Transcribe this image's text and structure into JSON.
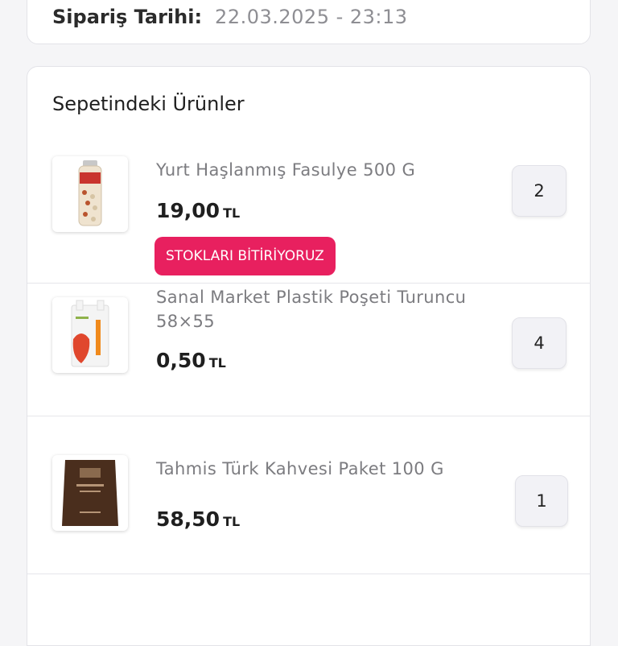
{
  "order": {
    "date_label": "Sipariş Tarihi:",
    "date_value": "22.03.2025 - 23:13"
  },
  "basket": {
    "title": "Sepetindeki Ürünler",
    "items": [
      {
        "name": "Yurt Haşlanmış Fasulye 500 G",
        "price": "19,00",
        "currency": "TL",
        "quantity": "2",
        "badge": "STOKLARI BİTİRİYORUZ"
      },
      {
        "name": "Sanal Market Plastik Poşeti Turuncu 58×55",
        "price": "0,50",
        "currency": "TL",
        "quantity": "4"
      },
      {
        "name": "Tahmis Türk Kahvesi Paket 100 G",
        "price": "58,50",
        "currency": "TL",
        "quantity": "1"
      }
    ]
  },
  "colors": {
    "badge": "#e8205f",
    "accent_text": "#1f1f1f",
    "muted_text": "#7c7c80"
  }
}
